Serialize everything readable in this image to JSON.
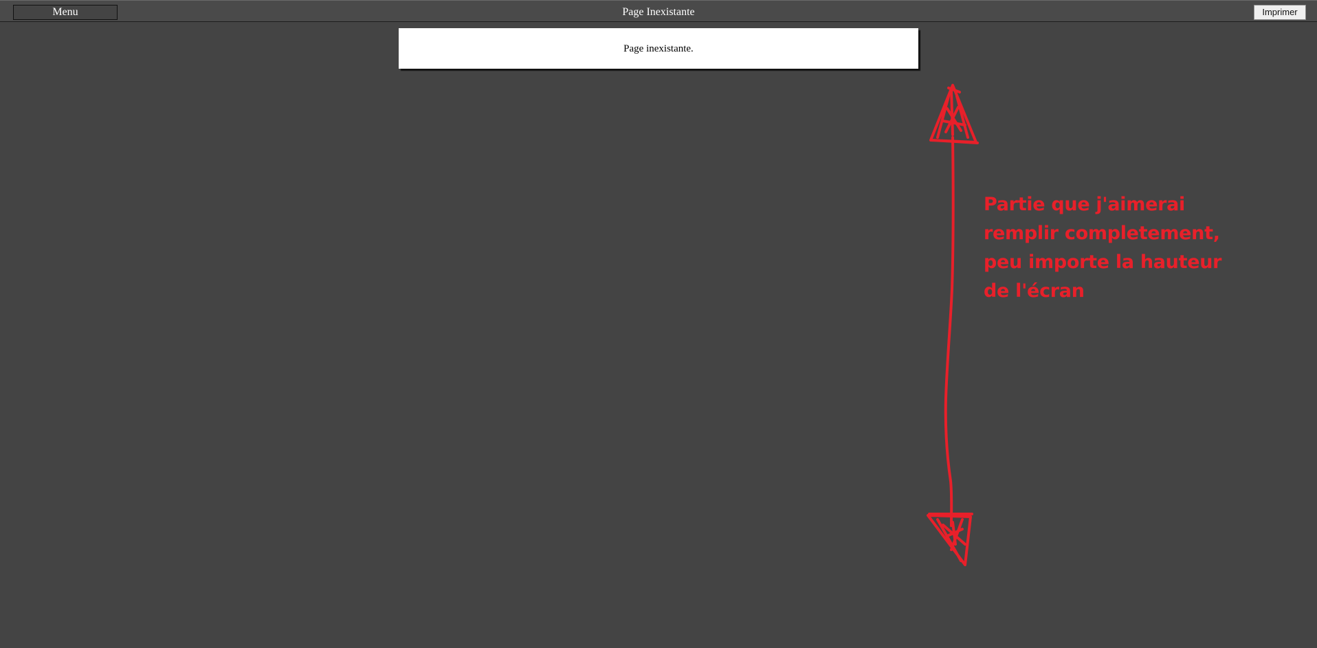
{
  "header": {
    "menu_label": "Menu",
    "title": "Page Inexistante",
    "print_label": "Imprimer"
  },
  "main": {
    "message": "Page inexistante."
  },
  "annotation": {
    "text": "Partie que j'aimerai remplir completement, peu importe la hauteur de l'écran",
    "color": "#e8202a"
  },
  "colors": {
    "background": "#444444",
    "topbar": "#4a4a4a",
    "card": "#ffffff"
  }
}
